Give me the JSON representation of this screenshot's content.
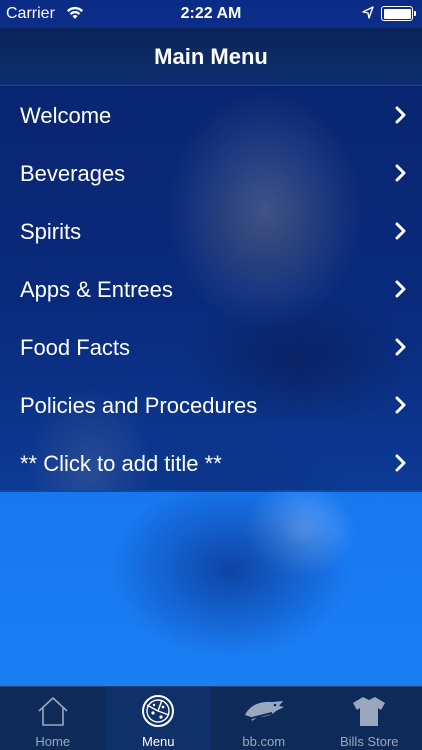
{
  "status_bar": {
    "carrier": "Carrier",
    "time": "2:22 AM",
    "battery_level": 1.0
  },
  "nav": {
    "title": "Main Menu"
  },
  "menu": {
    "items": [
      {
        "label": "Welcome"
      },
      {
        "label": "Beverages"
      },
      {
        "label": "Spirits"
      },
      {
        "label": "Apps & Entrees"
      },
      {
        "label": "Food Facts"
      },
      {
        "label": "Policies and Procedures"
      },
      {
        "label": "** Click to add title **"
      }
    ]
  },
  "tabbar": {
    "tabs": [
      {
        "label": "Home",
        "icon": "home-icon",
        "active": false
      },
      {
        "label": "Menu",
        "icon": "pizza-icon",
        "active": true
      },
      {
        "label": "bb.com",
        "icon": "bills-logo-icon",
        "active": false
      },
      {
        "label": "Bills Store",
        "icon": "jersey-icon",
        "active": false
      }
    ]
  },
  "colors": {
    "accent": "#0c2e70",
    "tab_bar": "#0e2a58",
    "text": "#ffffff",
    "inactive_tab": "#9aa8bf"
  }
}
